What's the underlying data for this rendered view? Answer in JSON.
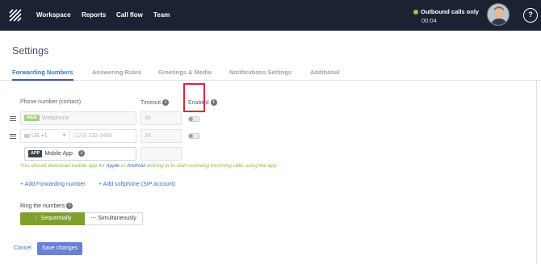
{
  "nav": {
    "items": [
      "Workspace",
      "Reports",
      "Call flow",
      "Team"
    ],
    "status_text": "Outbound calls only",
    "timer": "00:04",
    "help_symbol": "?",
    "status_color": "#8ccf4d"
  },
  "page": {
    "title": "Settings",
    "tabs": [
      "Forwarding Numbers",
      "Answering Rules",
      "Greetings & Media",
      "Notifications Settings",
      "Additional"
    ],
    "active_tab": "Forwarding Numbers"
  },
  "table": {
    "headers": {
      "phone": "Phone number (contact)",
      "timeout": "Timeout",
      "enabled": "Enabled"
    },
    "rows": [
      {
        "badge": "WEB",
        "value": "Webphone",
        "timeout": "30",
        "enabled": false
      },
      {
        "country": "US +1",
        "placeholder": "(123) 132-3466",
        "timeout": "24",
        "enabled": false
      }
    ],
    "app_row": {
      "badge": "APP",
      "value": "Mobile App"
    }
  },
  "hint": {
    "prefix": "You should download mobile app for ",
    "apple": "Apple",
    "middle": " or ",
    "android": "Android",
    "suffix": " and log in to start receiving incoming calls using the app."
  },
  "links": {
    "add_forwarding": "+ Add Forwarding number",
    "add_softphone": "+ Add softphone (SIP account)"
  },
  "ring": {
    "label": "Ring the numbers",
    "options": [
      "Sequentially",
      "Simultaneously"
    ],
    "selected": "Sequentially"
  },
  "actions": {
    "cancel": "Cancel",
    "save": "Save changes"
  }
}
